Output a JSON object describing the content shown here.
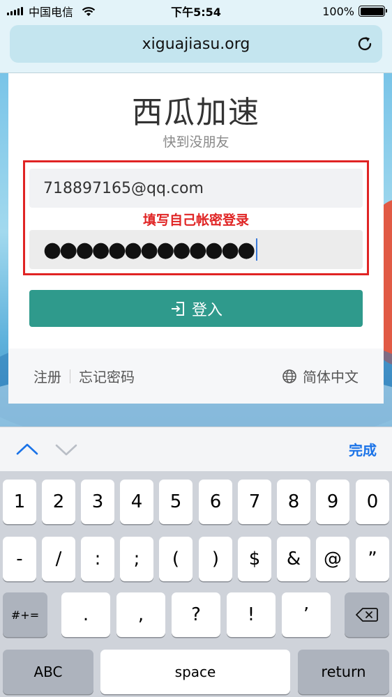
{
  "status_bar": {
    "carrier": "中国电信",
    "time": "下午5:54",
    "battery": "100%",
    "battery_level": 1.0
  },
  "browser": {
    "url": "xiguajiasu.org",
    "reload_icon": "reload-icon"
  },
  "login_card": {
    "title": "西瓜加速",
    "subtitle": "快到没朋友",
    "email_value": "718897165@qq.com",
    "password_masked": "●●●●●●●●●●●●●",
    "annotation": "填写自己帐密登录",
    "login_label": "登入",
    "register_label": "注册",
    "forgot_label": "忘记密码",
    "language_label": "简体中文"
  },
  "keyboard_toolbar": {
    "done_label": "完成"
  },
  "keyboard": {
    "row1": [
      "1",
      "2",
      "3",
      "4",
      "5",
      "6",
      "7",
      "8",
      "9",
      "0"
    ],
    "row2": [
      "-",
      "/",
      ":",
      ";",
      "(",
      ")",
      "$",
      "&",
      "@",
      "”"
    ],
    "row3_shift": "#+=",
    "row3": [
      ".",
      ",",
      "?",
      "!",
      "’"
    ],
    "abc": "ABC",
    "space": "space",
    "return": "return"
  },
  "colors": {
    "login_button": "#2f9a8c",
    "annotation_red": "#e02424",
    "done_blue": "#1a73e8"
  }
}
